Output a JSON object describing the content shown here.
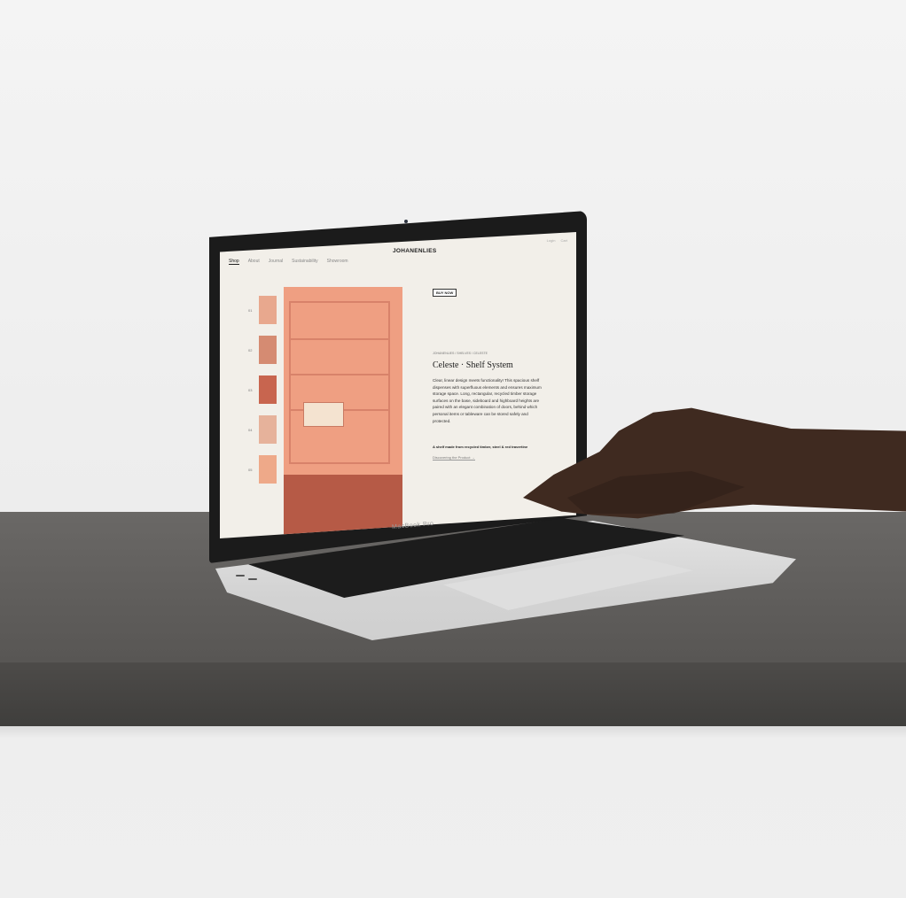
{
  "screen": {
    "nav": [
      "Shop",
      "About",
      "Journal",
      "Sustainability",
      "Showroom"
    ],
    "toplinks": [
      "Login",
      "Cart"
    ],
    "brand": "JOHANENLIES",
    "thumb_numbers": [
      "01",
      "02",
      "03",
      "04",
      "05"
    ],
    "buy_label": "BUY NOW",
    "breadcrumb": "JOHANENLIES / SHELVES / CELESTE",
    "product_title": "Celeste · Shelf System",
    "description": "Clear, linear design meets functionality! This spacious shelf dispenses with superfluous elements and ensures maximum storage space. Long, rectangular, recycled timber storage surfaces on the base, sideboard and highboard heights are paired with an elegant combination of doors, behind which personal items or tableware can be stored safely and protected.",
    "note": "A shelf made from recycled timber, steel & red travertine",
    "more_link": "Discovering the Product →"
  },
  "device_label": "MacBook Pro"
}
